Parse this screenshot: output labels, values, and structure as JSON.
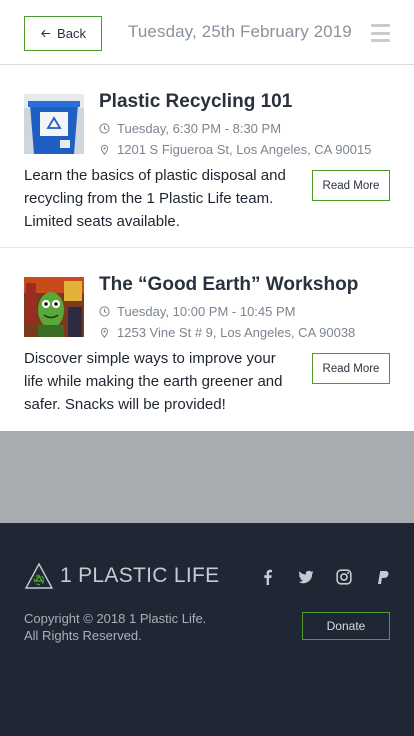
{
  "header": {
    "back_label": "Back",
    "date_title": "Tuesday, 25th February 2019"
  },
  "events": [
    {
      "title": "Plastic Recycling 101",
      "time": "Tuesday, 6:30 PM - 8:30 PM",
      "location": "1201 S Figueroa St, Los Angeles, CA 90015",
      "description": "Learn the basics of plastic disposal and recycling from the 1 Plastic Life team. Limited seats available.",
      "read_more_label": "Read More"
    },
    {
      "title": "The “Good Earth” Workshop",
      "time": "Tuesday, 10:00 PM - 10:45 PM",
      "location": "1253 Vine St # 9, Los Angeles, CA 90038",
      "description": "Discover simple ways to improve your life while making the earth greener and safer. Snacks will be provided!",
      "read_more_label": "Read More"
    }
  ],
  "footer": {
    "logo_text": "1 PLASTIC LIFE",
    "copyright_line1": "Copyright © 2018 1 Plastic Life.",
    "copyright_line2": "All Rights Reserved.",
    "donate_label": "Donate",
    "social_icons": [
      "facebook-icon",
      "twitter-icon",
      "instagram-icon",
      "paypal-icon"
    ]
  },
  "colors": {
    "accent_green": "#4f9a2b",
    "footer_bg": "#1e2733",
    "spacer_gray": "#a8acb0",
    "muted_text": "#8a939d"
  }
}
